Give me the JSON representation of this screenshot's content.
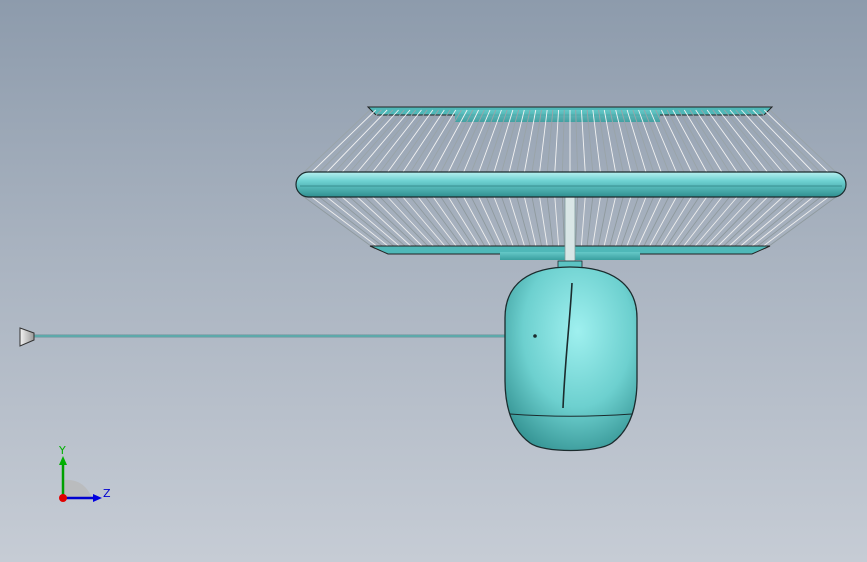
{
  "viewport": {
    "colors": {
      "background_top": "#8d9bac",
      "background_bottom": "#c6ccd5",
      "model_body": "#74d3d3",
      "model_edge": "#1b2b2d",
      "wire": "#e8e8e8",
      "x_axis": "#e00000",
      "y_axis": "#00a000",
      "z_axis": "#0000d0"
    }
  },
  "triad": {
    "y_label": "Y",
    "z_label": "Z"
  },
  "model": {
    "parts": [
      "lamp-shade",
      "lamp-base",
      "power-cord",
      "cord-plug"
    ]
  }
}
